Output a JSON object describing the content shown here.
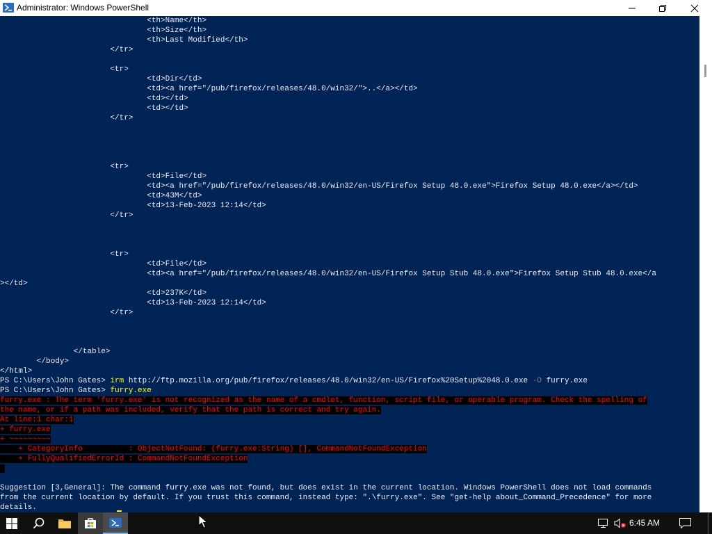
{
  "window": {
    "title": "Administrator: Windows PowerShell",
    "controls": {
      "minimize": "minimize",
      "maximize": "maximize",
      "close": "close"
    }
  },
  "console": {
    "lines": [
      "                                <th>Name</th>",
      "                                <th>Size</th>",
      "                                <th>Last Modified</th>",
      "                        </tr>",
      "",
      "                        <tr>",
      "                                <td>Dir</td>",
      "                                <td><a href=\"/pub/firefox/releases/48.0/win32/\">..</a></td>",
      "                                <td></td>",
      "                                <td></td>",
      "                        </tr>",
      "",
      "",
      "",
      "",
      "                        <tr>",
      "                                <td>File</td>",
      "                                <td><a href=\"/pub/firefox/releases/48.0/win32/en-US/Firefox Setup 48.0.exe\">Firefox Setup 48.0.exe</a></td>",
      "                                <td>43M</td>",
      "                                <td>13-Feb-2023 12:14</td>",
      "                        </tr>",
      "",
      "",
      "",
      "                        <tr>",
      "                                <td>File</td>",
      "                                <td><a href=\"/pub/firefox/releases/48.0/win32/en-US/Firefox Setup Stub 48.0.exe\">Firefox Setup Stub 48.0.exe</a",
      "></td>",
      "                                <td>237K</td>",
      "                                <td>13-Feb-2023 12:14</td>",
      "                        </tr>",
      "",
      "",
      "",
      "                </table>",
      "        </body>",
      "</html>"
    ],
    "prompt": "PS C:\\Users\\John Gates> ",
    "cmd1": {
      "command": "irm",
      "arg": " http://ftp.mozilla.org/pub/firefox/releases/48.0/win32/en-US/Firefox%20Setup%2048.0.exe",
      "param": " -O",
      "value": " furry.exe"
    },
    "cmd2": {
      "command": "furry.exe"
    },
    "error": {
      "line1": "furry.exe : The term 'furry.exe' is not recognized as the name of a cmdlet, function, script file, or operable program. Check the spelling of",
      "line2": "the name, or if a path was included, verify that the path is correct and try again.",
      "line3": "At line:1 char:1",
      "line4": "+ furry.exe",
      "line5": "+ ~~~~~~~~~",
      "line6": "    + CategoryInfo          : ObjectNotFound: (furry.exe:String) [], CommandNotFoundException",
      "line7": "    + FullyQualifiedErrorId : CommandNotFoundException",
      "line8": " "
    },
    "suggestion": [
      "Suggestion [3,General]: The command furry.exe was not found, but does exist in the current location. Windows PowerShell does not load commands",
      "from the current location by default. If you trust this command, instead type: \".\\furry.exe\". See \"get-help about_Command_Precedence\" for more",
      "details."
    ]
  },
  "taskbar": {
    "start": "windows-start",
    "search": "search",
    "file_explorer": "file-explorer",
    "store": "microsoft-store",
    "powershell": "powershell",
    "clock": "6:45 AM"
  },
  "colors": {
    "console_bg": "#012456",
    "console_fg": "#eeedf0",
    "error_fg": "#ff0000",
    "command_fg": "#ffff00",
    "taskbar_bg": "#101010"
  }
}
